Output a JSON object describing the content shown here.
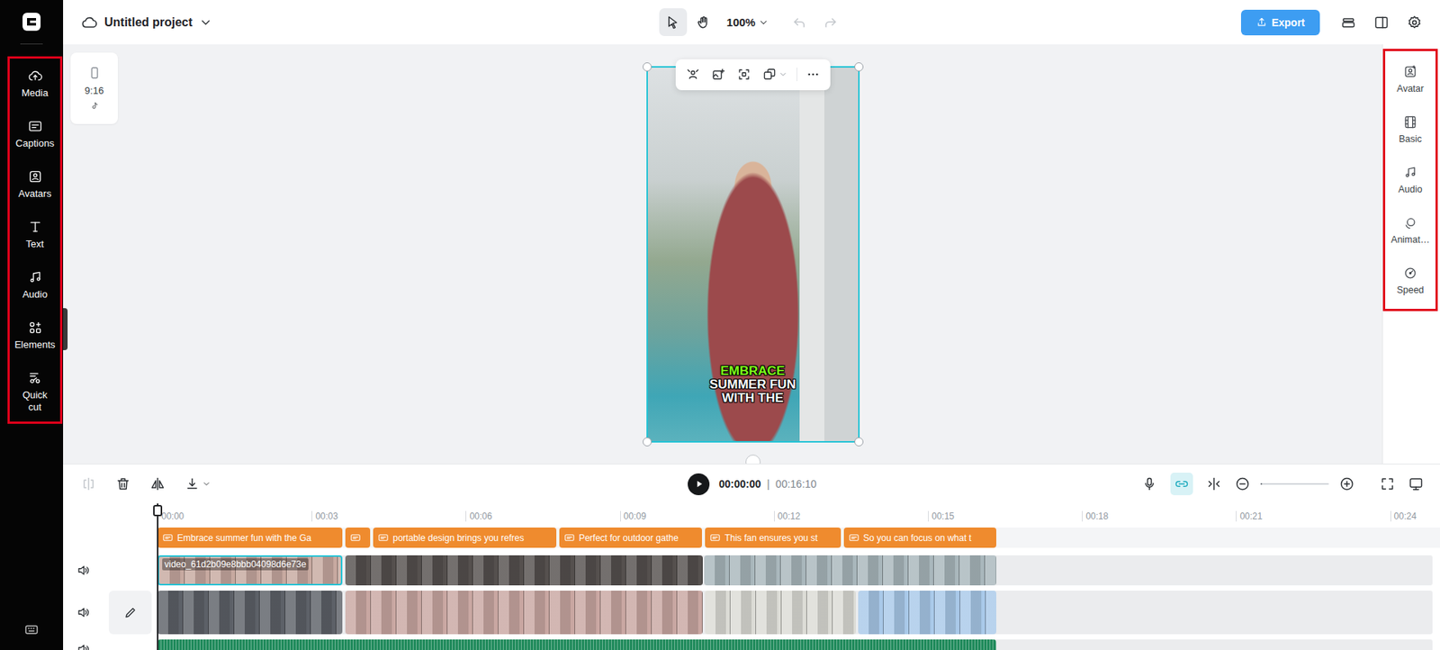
{
  "project": {
    "title": "Untitled project"
  },
  "sidebar": {
    "items": [
      {
        "label": "Media"
      },
      {
        "label": "Captions"
      },
      {
        "label": "Avatars"
      },
      {
        "label": "Text"
      },
      {
        "label": "Audio"
      },
      {
        "label": "Elements"
      },
      {
        "label": "Quick cut"
      }
    ]
  },
  "toolbar": {
    "tools": [
      {
        "kind": "select",
        "selected": true
      },
      {
        "kind": "hand",
        "selected": false
      }
    ],
    "zoom": "100%",
    "undo_disabled": true,
    "redo_disabled": true,
    "export": "Export"
  },
  "canvas": {
    "aspect": "9:16",
    "preview_caption": {
      "highlight": "EMBRACE",
      "rest": "SUMMER FUN WITH THE"
    }
  },
  "inspector": {
    "items": [
      {
        "label": "Avatar"
      },
      {
        "label": "Basic"
      },
      {
        "label": "Audio"
      },
      {
        "label": "Animat…"
      },
      {
        "label": "Speed"
      }
    ]
  },
  "player": {
    "current": "00:00:00",
    "separator": "|",
    "total": "00:16:10",
    "split_disabled": true,
    "snap_on": true,
    "zoom_level": 0.02
  },
  "timeline": {
    "ruler": [
      "00:00",
      "00:03",
      "00:06",
      "00:09",
      "00:12",
      "00:15",
      "00:18",
      "00:21",
      "00:24"
    ],
    "captions": [
      {
        "text": "Embrace summer fun with the Ga",
        "start": 0,
        "end": 3.6
      },
      {
        "text": "",
        "start": 3.66,
        "end": 4.14
      },
      {
        "text": "portable design brings you refres",
        "start": 4.2,
        "end": 7.76
      },
      {
        "text": "Perfect for outdoor gathe",
        "start": 7.82,
        "end": 10.6
      },
      {
        "text": "This fan ensures you st",
        "start": 10.66,
        "end": 13.3
      },
      {
        "text": "So you can focus on what t",
        "start": 13.36,
        "end": 16.33
      }
    ],
    "tracks": [
      {
        "kind": "video",
        "muted": false,
        "clips": [
          {
            "label": "video_61d2b09e8bbb04098d6e73e",
            "selected": true,
            "start": 0,
            "end": 3.6,
            "color": "#c7a9a0"
          },
          {
            "label": "",
            "selected": false,
            "start": 3.66,
            "end": 10.62,
            "color": "#55504e"
          },
          {
            "label": "",
            "selected": false,
            "start": 10.64,
            "end": 16.33,
            "color": "#a9b7bc"
          }
        ]
      },
      {
        "kind": "main",
        "muted": false,
        "clips": [
          {
            "label": "",
            "selected": false,
            "start": 0,
            "end": 3.6,
            "color": "#5d6168"
          },
          {
            "label": "",
            "selected": false,
            "start": 3.66,
            "end": 10.62,
            "color": "#c9a7a2"
          },
          {
            "label": "",
            "selected": false,
            "start": 10.66,
            "end": 13.6,
            "color": "#dcdcd6"
          },
          {
            "label": "",
            "selected": false,
            "start": 13.64,
            "end": 16.33,
            "color": "#a9c9e9"
          }
        ]
      },
      {
        "kind": "audio",
        "muted": false,
        "clips": [
          {
            "label": "",
            "selected": false,
            "start": 0,
            "end": 16.33,
            "color": "#1f8a5b"
          }
        ]
      }
    ]
  }
}
